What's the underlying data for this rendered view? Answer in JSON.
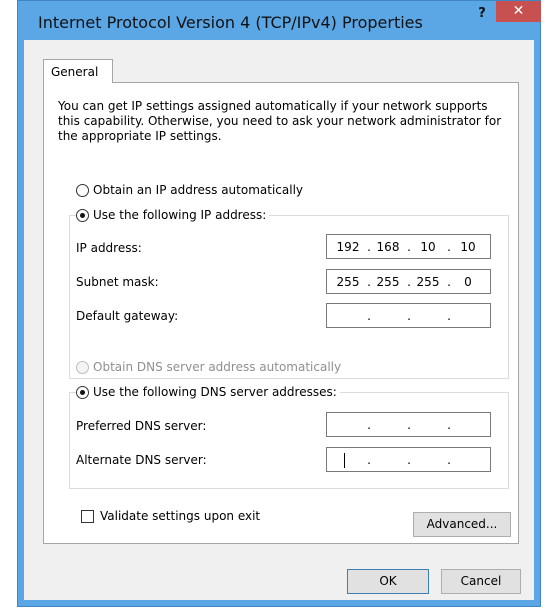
{
  "window": {
    "title": "Internet Protocol Version 4 (TCP/IPv4) Properties",
    "help": "?",
    "close": "✕"
  },
  "tab": {
    "label": "General"
  },
  "description": "You can get IP settings assigned automatically if your network supports this capability. Otherwise, you need to ask your network administrator for the appropriate IP settings.",
  "ip_options": {
    "auto_label": "Obtain an IP address automatically",
    "manual_label": "Use the following IP address:",
    "selected": "manual"
  },
  "ip_fields": {
    "ip_address": {
      "label": "IP address:",
      "octets": [
        "192",
        "168",
        "10",
        "10"
      ]
    },
    "subnet_mask": {
      "label": "Subnet mask:",
      "octets": [
        "255",
        "255",
        "255",
        "0"
      ]
    },
    "default_gateway": {
      "label": "Default gateway:",
      "octets": [
        "",
        "",
        "",
        ""
      ]
    }
  },
  "dns_options": {
    "auto_label": "Obtain DNS server address automatically",
    "manual_label": "Use the following DNS server addresses:",
    "selected": "manual",
    "auto_disabled": true
  },
  "dns_fields": {
    "preferred": {
      "label": "Preferred DNS server:",
      "octets": [
        "",
        "",
        "",
        ""
      ]
    },
    "alternate": {
      "label": "Alternate DNS server:",
      "octets": [
        "",
        "",
        "",
        ""
      ]
    }
  },
  "validate": {
    "label": "Validate settings upon exit",
    "checked": false
  },
  "buttons": {
    "advanced": "Advanced...",
    "ok": "OK",
    "cancel": "Cancel"
  },
  "colors": {
    "title_bar": "#5ba7e6",
    "close_button": "#c75050",
    "dialog_bg": "#f0f0f0"
  }
}
